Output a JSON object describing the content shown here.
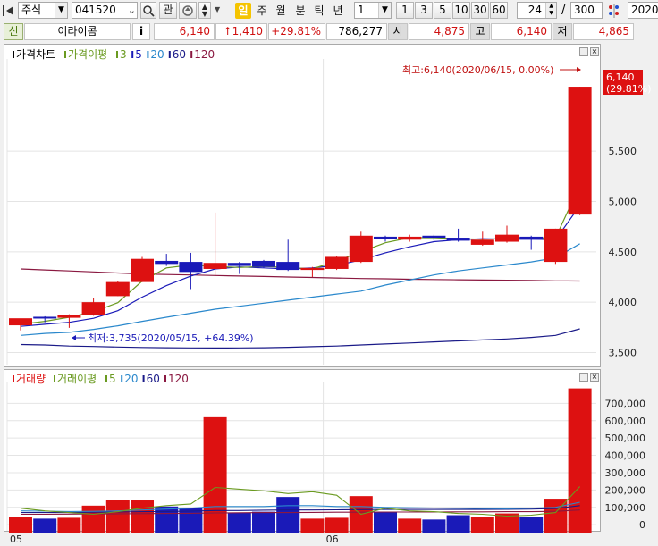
{
  "toolbar": {
    "market_type": "주식",
    "stock_code": "041520",
    "btn_watch": "관",
    "periods": [
      "일",
      "주",
      "월",
      "분",
      "틱",
      "년"
    ],
    "period_active": "일",
    "interval_value": "1",
    "quick_nums": [
      "1",
      "3",
      "5",
      "10",
      "30",
      "60"
    ],
    "count_value": "24",
    "count_sep": "/",
    "count_total": "300",
    "date_value": "2020/"
  },
  "quote": {
    "credit_label": "신",
    "stock_name": "이라이콤",
    "info_btn": "i",
    "price": "6,140",
    "change": "↑1,410",
    "change_rate": "+29.81%",
    "volume": "786,277",
    "open_label": "시",
    "open": "4,875",
    "high_label": "고",
    "high": "6,140",
    "low_label": "저",
    "low": "4,865"
  },
  "colors": {
    "up": "#dd1111",
    "down": "#1a1ab8",
    "ma3": "#6a9a20",
    "ma5": "#1a1ab8",
    "ma20": "#2a88cc",
    "ma60": "#1a1a88",
    "ma120": "#8a1840"
  },
  "price_panel": {
    "legend": [
      {
        "text": "가격차트",
        "color": "#000000"
      },
      {
        "text": "가격이평",
        "color": "#6a9a20"
      },
      {
        "text": "3",
        "color": "#6a9a20"
      },
      {
        "text": "5",
        "color": "#1a1ab8"
      },
      {
        "text": "20",
        "color": "#2a88cc"
      },
      {
        "text": "60",
        "color": "#1a1a88"
      },
      {
        "text": "120",
        "color": "#8a1840"
      }
    ],
    "high_note": "최고:6,140(2020/06/15, 0.00%)",
    "low_note": "최저:3,735(2020/05/15, +64.39%)",
    "last_price_tag": "6,140",
    "last_rate_tag": "(29.81%)"
  },
  "volume_panel": {
    "legend": [
      {
        "text": "거래량",
        "color": "#dd1111"
      },
      {
        "text": "거래이평",
        "color": "#6a9a20"
      },
      {
        "text": "5",
        "color": "#6a9a20"
      },
      {
        "text": "20",
        "color": "#2a88cc"
      },
      {
        "text": "60",
        "color": "#1a1a88"
      },
      {
        "text": "120",
        "color": "#8a1840"
      }
    ]
  },
  "x_labels": [
    {
      "index": 0,
      "text": "05"
    },
    {
      "index": 13,
      "text": "06"
    }
  ],
  "chart_data": {
    "type": "candlestick",
    "price_axis_ticks": [
      3500,
      4000,
      4500,
      5000,
      5500
    ],
    "price_ylim": [
      3380,
      6380
    ],
    "volume_axis_ticks": [
      0,
      100000,
      200000,
      300000,
      400000,
      500000,
      600000,
      700000
    ],
    "volume_ylim": [
      -30000,
      810000
    ],
    "candles": [
      {
        "o": 3770,
        "h": 3830,
        "l": 3720,
        "c": 3840
      },
      {
        "o": 3855,
        "h": 3860,
        "l": 3800,
        "c": 3845
      },
      {
        "o": 3845,
        "h": 3880,
        "l": 3745,
        "c": 3870
      },
      {
        "o": 3870,
        "h": 4040,
        "l": 3865,
        "c": 4000
      },
      {
        "o": 4060,
        "h": 4210,
        "l": 4060,
        "c": 4200
      },
      {
        "o": 4200,
        "h": 4450,
        "l": 4200,
        "c": 4430
      },
      {
        "o": 4410,
        "h": 4480,
        "l": 4360,
        "c": 4380
      },
      {
        "o": 4400,
        "h": 4490,
        "l": 4130,
        "c": 4300
      },
      {
        "o": 4330,
        "h": 4890,
        "l": 4260,
        "c": 4390
      },
      {
        "o": 4390,
        "h": 4400,
        "l": 4280,
        "c": 4360
      },
      {
        "o": 4410,
        "h": 4420,
        "l": 4340,
        "c": 4350
      },
      {
        "o": 4400,
        "h": 4620,
        "l": 4310,
        "c": 4320
      },
      {
        "o": 4320,
        "h": 4350,
        "l": 4250,
        "c": 4340
      },
      {
        "o": 4330,
        "h": 4460,
        "l": 4320,
        "c": 4450
      },
      {
        "o": 4400,
        "h": 4700,
        "l": 4390,
        "c": 4660
      },
      {
        "o": 4650,
        "h": 4660,
        "l": 4600,
        "c": 4630
      },
      {
        "o": 4620,
        "h": 4670,
        "l": 4600,
        "c": 4650
      },
      {
        "o": 4660,
        "h": 4670,
        "l": 4610,
        "c": 4640
      },
      {
        "o": 4640,
        "h": 4730,
        "l": 4600,
        "c": 4610
      },
      {
        "o": 4570,
        "h": 4700,
        "l": 4560,
        "c": 4620
      },
      {
        "o": 4600,
        "h": 4760,
        "l": 4590,
        "c": 4670
      },
      {
        "o": 4650,
        "h": 4660,
        "l": 4520,
        "c": 4620
      },
      {
        "o": 4400,
        "h": 4730,
        "l": 4380,
        "c": 4730
      },
      {
        "o": 4870,
        "h": 6140,
        "l": 4865,
        "c": 6140
      }
    ],
    "volume": [
      45000,
      35000,
      40000,
      110000,
      145000,
      140000,
      105000,
      95000,
      620000,
      70000,
      75000,
      160000,
      35000,
      40000,
      165000,
      75000,
      35000,
      30000,
      55000,
      45000,
      65000,
      45000,
      150000,
      786277
    ],
    "price_ma": {
      "ma3": [
        3780,
        3810,
        3850,
        3905,
        3995,
        4210,
        4340,
        4370,
        4355,
        4345,
        4355,
        4345,
        4330,
        4410,
        4500,
        4590,
        4640,
        4640,
        4630,
        4625,
        4630,
        4635,
        4640,
        5160
      ],
      "ma5": [
        3760,
        3780,
        3800,
        3840,
        3915,
        4050,
        4165,
        4260,
        4330,
        4350,
        4340,
        4330,
        4340,
        4365,
        4420,
        4490,
        4550,
        4600,
        4620,
        4630,
        4625,
        4625,
        4620,
        4960
      ],
      "ma20": [
        3670,
        3690,
        3700,
        3730,
        3765,
        3810,
        3850,
        3890,
        3930,
        3960,
        3990,
        4020,
        4050,
        4080,
        4110,
        4170,
        4220,
        4270,
        4310,
        4340,
        4370,
        4400,
        4440,
        4580
      ],
      "ma60": [
        3580,
        3575,
        3565,
        3560,
        3555,
        3550,
        3548,
        3546,
        3545,
        3546,
        3548,
        3552,
        3558,
        3565,
        3575,
        3585,
        3595,
        3605,
        3615,
        3625,
        3635,
        3650,
        3670,
        3735
      ],
      "ma120": [
        4330,
        4320,
        4310,
        4300,
        4290,
        4280,
        4275,
        4270,
        4265,
        4260,
        4255,
        4250,
        4245,
        4240,
        4235,
        4232,
        4228,
        4225,
        4222,
        4220,
        4218,
        4215,
        4212,
        4210
      ]
    },
    "volume_ma": {
      "ma5": [
        95000,
        80000,
        70000,
        60000,
        75000,
        95000,
        110000,
        120000,
        215000,
        205000,
        195000,
        180000,
        190000,
        170000,
        60000,
        95000,
        80000,
        75000,
        65000,
        60000,
        50000,
        55000,
        70000,
        220000
      ],
      "ma20": [
        80000,
        78000,
        76000,
        77000,
        80000,
        85000,
        90000,
        95000,
        105000,
        105000,
        105000,
        110000,
        110000,
        105000,
        105000,
        100000,
        98000,
        96000,
        95000,
        93000,
        92000,
        95000,
        100000,
        130000
      ],
      "ma60": [
        70000,
        70000,
        70000,
        72000,
        73000,
        75000,
        76000,
        78000,
        82000,
        82000,
        84000,
        85000,
        85000,
        86000,
        87000,
        88000,
        88000,
        88000,
        88000,
        88000,
        89000,
        90000,
        93000,
        110000
      ],
      "ma120": [
        60000,
        60000,
        61000,
        62000,
        63000,
        64000,
        65000,
        66000,
        68000,
        69000,
        70000,
        70000,
        71000,
        72000,
        72000,
        73000,
        73000,
        73000,
        74000,
        74000,
        75000,
        75000,
        77000,
        85000
      ]
    }
  }
}
